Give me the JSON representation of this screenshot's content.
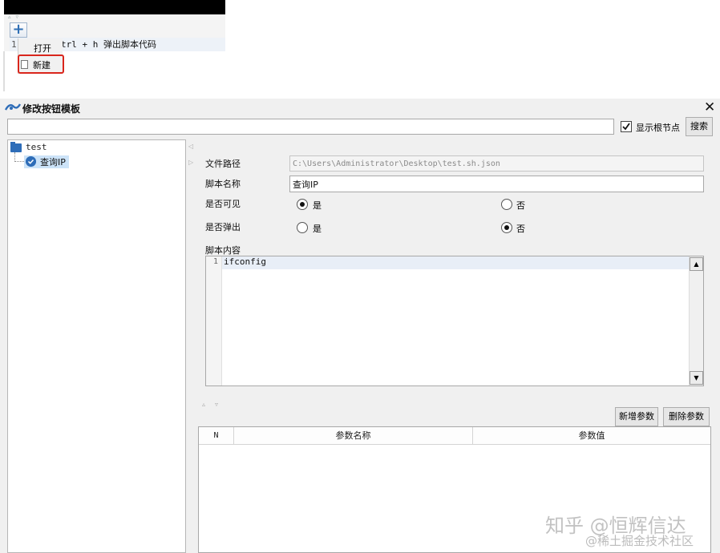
{
  "snippet": {
    "plus_label": "+",
    "line_number": "1",
    "code_hint": "trl + h 弹出脚本代码",
    "menu": {
      "open_label": "打开",
      "new_label": "新建"
    }
  },
  "dialog": {
    "title": "修改按钮模板",
    "close_glyph": "✕",
    "search": {
      "value": "",
      "placeholder": ""
    },
    "show_root_label": "显示根节点",
    "show_root_checked": true,
    "search_button": "搜索",
    "tree": {
      "root_label": "test",
      "children": [
        {
          "label": "查询IP",
          "selected": true
        }
      ]
    },
    "form": {
      "path_label": "文件路径",
      "path_value": "C:\\Users\\Administrator\\Desktop\\test.sh.json",
      "name_label": "脚本名称",
      "name_value": "查询IP",
      "visible_label": "是否可见",
      "visible_yes": "是",
      "visible_no": "否",
      "visible_selected": "是",
      "popup_label": "是否弹出",
      "popup_yes": "是",
      "popup_no": "否",
      "popup_selected": "否",
      "content_label": "脚本内容",
      "code_line_number": "1",
      "code_text": "ifconfig"
    },
    "params": {
      "add_button": "新增参数",
      "delete_button": "删除参数",
      "columns": [
        "N",
        "参数名称",
        "参数值"
      ],
      "rows": []
    }
  },
  "watermark": {
    "line1": "知乎 @恒辉信达",
    "line2": "@稀土掘金技术社区"
  },
  "colors": {
    "accent": "#2e6db8",
    "highlight_box": "#d9261c",
    "selection": "#cce3f8"
  }
}
